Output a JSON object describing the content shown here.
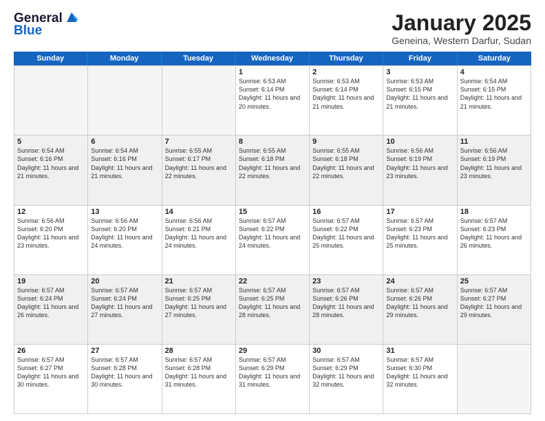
{
  "header": {
    "logo_line1": "General",
    "logo_line2": "Blue",
    "month_title": "January 2025",
    "location": "Geneina, Western Darfur, Sudan"
  },
  "weekdays": [
    "Sunday",
    "Monday",
    "Tuesday",
    "Wednesday",
    "Thursday",
    "Friday",
    "Saturday"
  ],
  "weeks": [
    [
      {
        "day": "",
        "text": "",
        "empty": true
      },
      {
        "day": "",
        "text": "",
        "empty": true
      },
      {
        "day": "",
        "text": "",
        "empty": true
      },
      {
        "day": "1",
        "text": "Sunrise: 6:53 AM\nSunset: 6:14 PM\nDaylight: 11 hours\nand 20 minutes.",
        "empty": false
      },
      {
        "day": "2",
        "text": "Sunrise: 6:53 AM\nSunset: 6:14 PM\nDaylight: 11 hours\nand 21 minutes.",
        "empty": false
      },
      {
        "day": "3",
        "text": "Sunrise: 6:53 AM\nSunset: 6:15 PM\nDaylight: 11 hours\nand 21 minutes.",
        "empty": false
      },
      {
        "day": "4",
        "text": "Sunrise: 6:54 AM\nSunset: 6:15 PM\nDaylight: 11 hours\nand 21 minutes.",
        "empty": false
      }
    ],
    [
      {
        "day": "5",
        "text": "Sunrise: 6:54 AM\nSunset: 6:16 PM\nDaylight: 11 hours\nand 21 minutes.",
        "empty": false
      },
      {
        "day": "6",
        "text": "Sunrise: 6:54 AM\nSunset: 6:16 PM\nDaylight: 11 hours\nand 21 minutes.",
        "empty": false
      },
      {
        "day": "7",
        "text": "Sunrise: 6:55 AM\nSunset: 6:17 PM\nDaylight: 11 hours\nand 22 minutes.",
        "empty": false
      },
      {
        "day": "8",
        "text": "Sunrise: 6:55 AM\nSunset: 6:18 PM\nDaylight: 11 hours\nand 22 minutes.",
        "empty": false
      },
      {
        "day": "9",
        "text": "Sunrise: 6:55 AM\nSunset: 6:18 PM\nDaylight: 11 hours\nand 22 minutes.",
        "empty": false
      },
      {
        "day": "10",
        "text": "Sunrise: 6:56 AM\nSunset: 6:19 PM\nDaylight: 11 hours\nand 23 minutes.",
        "empty": false
      },
      {
        "day": "11",
        "text": "Sunrise: 6:56 AM\nSunset: 6:19 PM\nDaylight: 11 hours\nand 23 minutes.",
        "empty": false
      }
    ],
    [
      {
        "day": "12",
        "text": "Sunrise: 6:56 AM\nSunset: 6:20 PM\nDaylight: 11 hours\nand 23 minutes.",
        "empty": false
      },
      {
        "day": "13",
        "text": "Sunrise: 6:56 AM\nSunset: 6:20 PM\nDaylight: 11 hours\nand 24 minutes.",
        "empty": false
      },
      {
        "day": "14",
        "text": "Sunrise: 6:56 AM\nSunset: 6:21 PM\nDaylight: 11 hours\nand 24 minutes.",
        "empty": false
      },
      {
        "day": "15",
        "text": "Sunrise: 6:57 AM\nSunset: 6:22 PM\nDaylight: 11 hours\nand 24 minutes.",
        "empty": false
      },
      {
        "day": "16",
        "text": "Sunrise: 6:57 AM\nSunset: 6:22 PM\nDaylight: 11 hours\nand 25 minutes.",
        "empty": false
      },
      {
        "day": "17",
        "text": "Sunrise: 6:57 AM\nSunset: 6:23 PM\nDaylight: 11 hours\nand 25 minutes.",
        "empty": false
      },
      {
        "day": "18",
        "text": "Sunrise: 6:57 AM\nSunset: 6:23 PM\nDaylight: 11 hours\nand 26 minutes.",
        "empty": false
      }
    ],
    [
      {
        "day": "19",
        "text": "Sunrise: 6:57 AM\nSunset: 6:24 PM\nDaylight: 11 hours\nand 26 minutes.",
        "empty": false
      },
      {
        "day": "20",
        "text": "Sunrise: 6:57 AM\nSunset: 6:24 PM\nDaylight: 11 hours\nand 27 minutes.",
        "empty": false
      },
      {
        "day": "21",
        "text": "Sunrise: 6:57 AM\nSunset: 6:25 PM\nDaylight: 11 hours\nand 27 minutes.",
        "empty": false
      },
      {
        "day": "22",
        "text": "Sunrise: 6:57 AM\nSunset: 6:25 PM\nDaylight: 11 hours\nand 28 minutes.",
        "empty": false
      },
      {
        "day": "23",
        "text": "Sunrise: 6:57 AM\nSunset: 6:26 PM\nDaylight: 11 hours\nand 28 minutes.",
        "empty": false
      },
      {
        "day": "24",
        "text": "Sunrise: 6:57 AM\nSunset: 6:26 PM\nDaylight: 11 hours\nand 29 minutes.",
        "empty": false
      },
      {
        "day": "25",
        "text": "Sunrise: 6:57 AM\nSunset: 6:27 PM\nDaylight: 11 hours\nand 29 minutes.",
        "empty": false
      }
    ],
    [
      {
        "day": "26",
        "text": "Sunrise: 6:57 AM\nSunset: 6:27 PM\nDaylight: 11 hours\nand 30 minutes.",
        "empty": false
      },
      {
        "day": "27",
        "text": "Sunrise: 6:57 AM\nSunset: 6:28 PM\nDaylight: 11 hours\nand 30 minutes.",
        "empty": false
      },
      {
        "day": "28",
        "text": "Sunrise: 6:57 AM\nSunset: 6:28 PM\nDaylight: 11 hours\nand 31 minutes.",
        "empty": false
      },
      {
        "day": "29",
        "text": "Sunrise: 6:57 AM\nSunset: 6:29 PM\nDaylight: 11 hours\nand 31 minutes.",
        "empty": false
      },
      {
        "day": "30",
        "text": "Sunrise: 6:57 AM\nSunset: 6:29 PM\nDaylight: 11 hours\nand 32 minutes.",
        "empty": false
      },
      {
        "day": "31",
        "text": "Sunrise: 6:57 AM\nSunset: 6:30 PM\nDaylight: 11 hours\nand 32 minutes.",
        "empty": false
      },
      {
        "day": "",
        "text": "",
        "empty": true
      }
    ]
  ]
}
